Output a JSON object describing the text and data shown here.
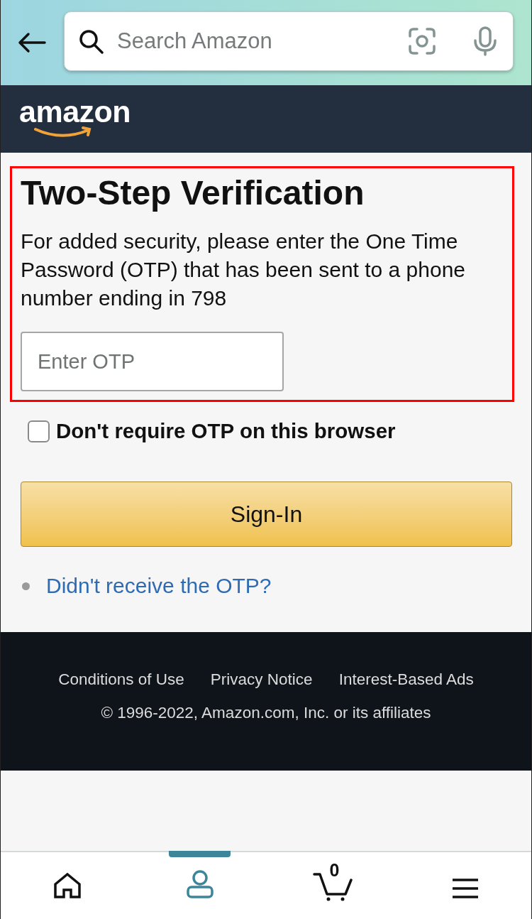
{
  "header": {
    "search": {
      "placeholder": "Search Amazon"
    }
  },
  "logo": {
    "text": "amazon"
  },
  "verification": {
    "title": "Two-Step Verification",
    "message": "For added security, please enter the One Time Password (OTP) that has been sent to a phone number ending in 798",
    "otp_field": {
      "placeholder": "Enter OTP"
    }
  },
  "remember_option": {
    "label": "Don't require OTP on this browser",
    "checked": false
  },
  "sign_in_button": {
    "label": "Sign-In"
  },
  "help_links": [
    {
      "label": "Didn't receive the OTP?"
    }
  ],
  "footer": {
    "links": [
      "Conditions of Use",
      "Privacy Notice",
      "Interest-Based Ads"
    ],
    "copyright": "© 1996-2022, Amazon.com, Inc. or its affiliates"
  },
  "bottom_nav": [
    {
      "kind": "home",
      "selected": false
    },
    {
      "kind": "account",
      "selected": true
    },
    {
      "kind": "cart",
      "selected": false,
      "count": "0"
    },
    {
      "kind": "menu",
      "selected": false
    }
  ]
}
